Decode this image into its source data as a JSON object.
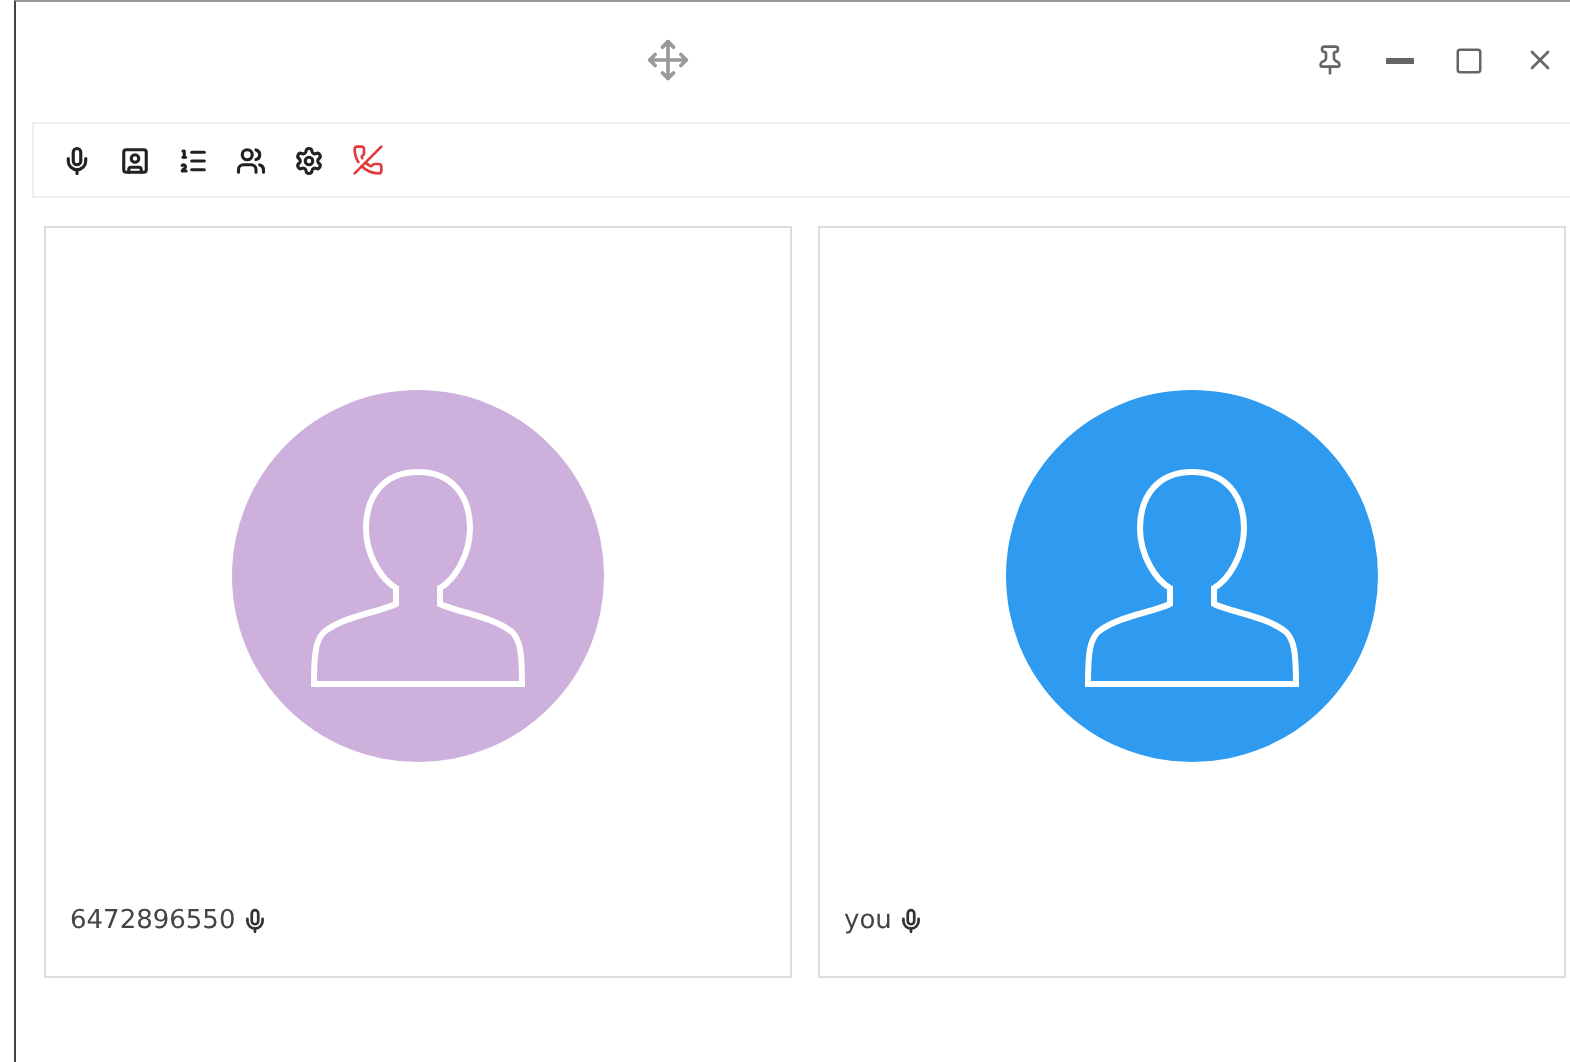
{
  "participants": [
    {
      "name": "6472896550",
      "color": "#cdb0dc"
    },
    {
      "name": "you",
      "color": "#2e9bf0"
    }
  ]
}
